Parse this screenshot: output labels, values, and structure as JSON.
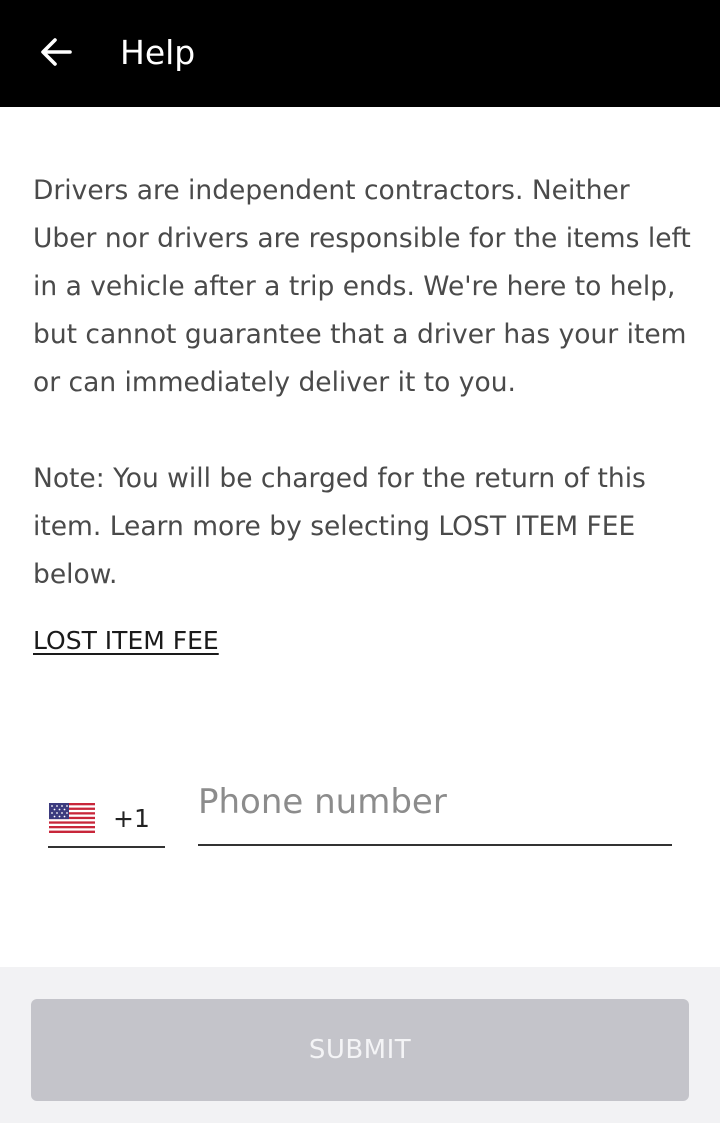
{
  "header": {
    "title": "Help",
    "back_icon": "arrow-left-icon",
    "background": "#000000"
  },
  "content": {
    "paragraph_1": "Drivers are independent contractors. Neither Uber nor drivers are responsible for the items left in a vehicle after a trip ends. We're here to help, but cannot guarantee that a driver has your item or can immediately deliver it to you.",
    "paragraph_2": "Note: You will be charged for the return of this item. Learn more by selecting LOST ITEM FEE below.",
    "fee_link": "LOST ITEM FEE"
  },
  "phone": {
    "country_flag": "us-flag-icon",
    "country_code": "+1",
    "value": "",
    "placeholder": "Phone number"
  },
  "footer": {
    "submit_label": "SUBMIT",
    "submit_color": "#c4c4ca"
  }
}
